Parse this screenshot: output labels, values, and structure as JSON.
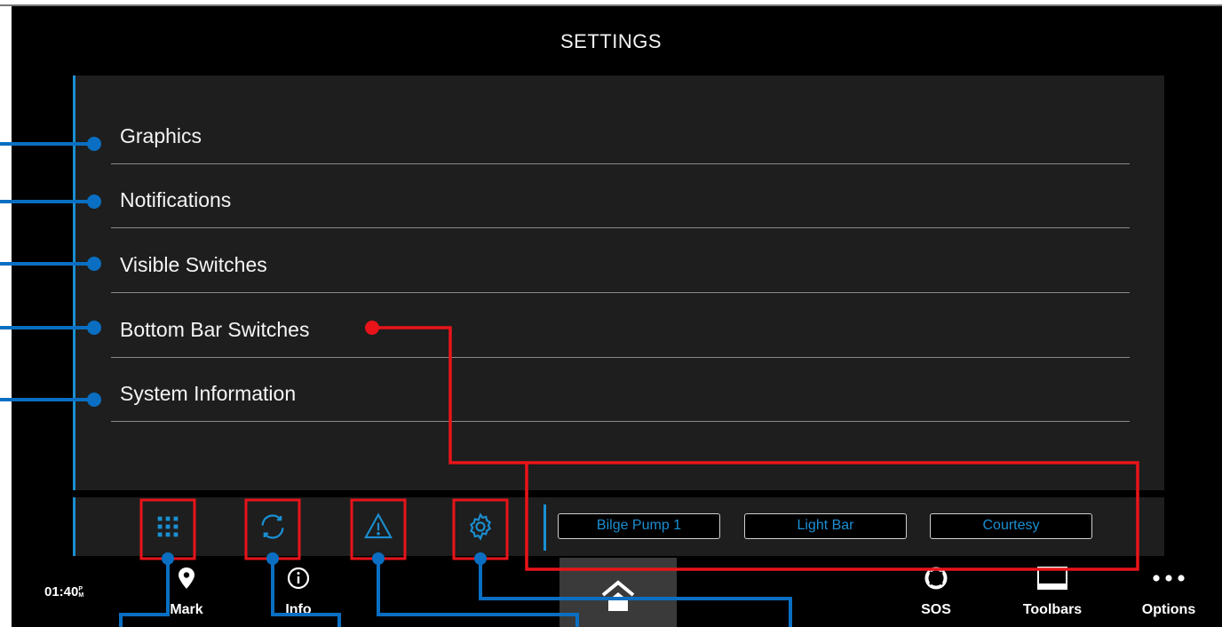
{
  "header": {
    "title": "SETTINGS"
  },
  "menu": [
    {
      "label": "Graphics"
    },
    {
      "label": "Notifications"
    },
    {
      "label": "Visible Switches"
    },
    {
      "label": "Bottom Bar Switches"
    },
    {
      "label": "System Information"
    }
  ],
  "toolbar": {
    "icons": [
      "grid-icon",
      "refresh-icon",
      "warning-icon",
      "gear-icon"
    ],
    "switches": [
      {
        "label": "Bilge Pump 1"
      },
      {
        "label": "Light Bar"
      },
      {
        "label": "Courtesy"
      }
    ]
  },
  "navbar": {
    "clock": "01:40",
    "ampm_top": "P",
    "ampm_bottom": "M",
    "mark_label": "Mark",
    "info_label": "Info",
    "sos_label": "SOS",
    "toolbars_label": "Toolbars",
    "options_label": "Options"
  },
  "colors": {
    "accent": "#1b8fd2",
    "callout_blue": "#0a6fc2",
    "callout_red": "#e8141a",
    "panel": "#1e1e1e",
    "background": "#000000"
  }
}
